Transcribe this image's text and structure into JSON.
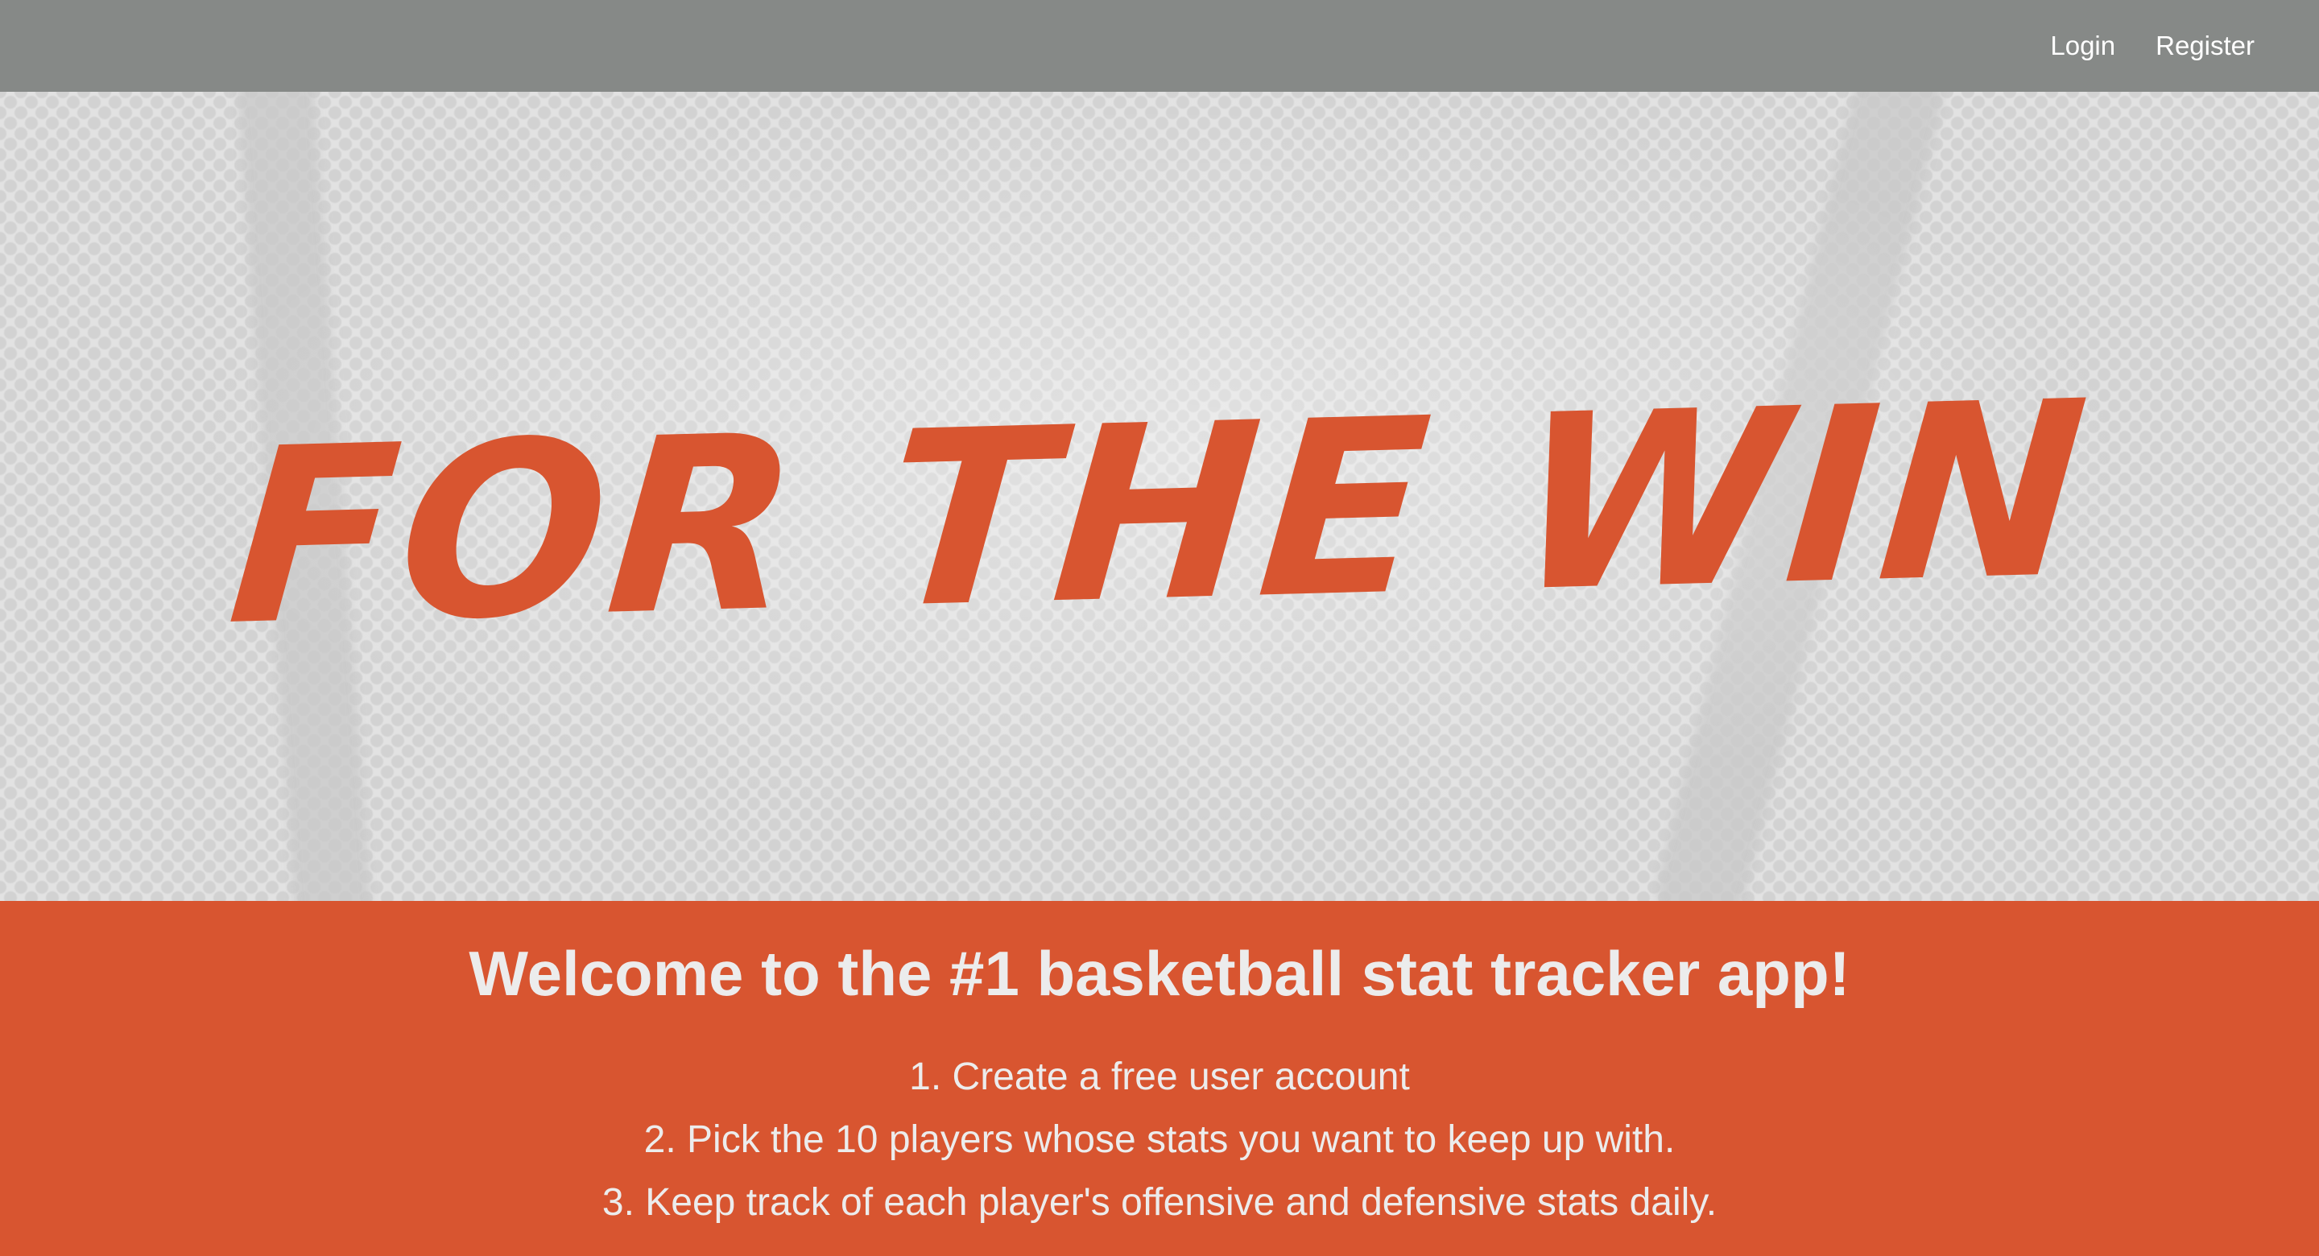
{
  "nav": {
    "links": [
      {
        "label": "Login"
      },
      {
        "label": "Register"
      }
    ]
  },
  "hero": {
    "title": "FOR THE WIN"
  },
  "intro": {
    "heading": "Welcome to the #1 basketball stat tracker app!",
    "steps": [
      "1. Create a free user account",
      "2. Pick the 10 players whose stats you want to keep up with.",
      "3. Keep track of each player's offensive and defensive stats daily."
    ]
  },
  "colors": {
    "navbar": "#868987",
    "accent": "#d85530",
    "light_text": "#ececec"
  }
}
